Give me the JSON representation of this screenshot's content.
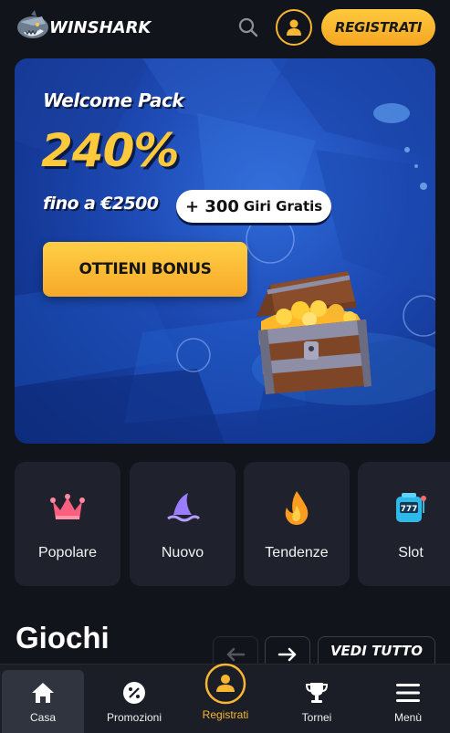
{
  "header": {
    "brand": "WINSHARK",
    "register_label": "REGISTRATI",
    "icons": [
      "shark-logo-icon",
      "search-icon",
      "user-icon"
    ]
  },
  "banner": {
    "title": "Welcome Pack",
    "percent": "240%",
    "upto": "fino a €2500",
    "spins_plus": "+ 300",
    "spins_text": "Giri Gratis",
    "cta": "OTTIENI BONUS"
  },
  "categories": [
    {
      "label": "Popolare",
      "icon": "crown-icon"
    },
    {
      "label": "Nuovo",
      "icon": "shark-fin-icon"
    },
    {
      "label": "Tendenze",
      "icon": "flame-icon"
    },
    {
      "label": "Slot",
      "icon": "slot-machine-icon"
    }
  ],
  "games": {
    "title": "Giochi",
    "view_all": "VEDI TUTTO"
  },
  "bottom_nav": [
    {
      "label": "Casa",
      "icon": "home-icon"
    },
    {
      "label": "Promozioni",
      "icon": "percent-icon"
    },
    {
      "label": "Registrati",
      "icon": "user-icon"
    },
    {
      "label": "Tornei",
      "icon": "trophy-icon"
    },
    {
      "label": "Menù",
      "icon": "hamburger-menu-icon"
    }
  ],
  "colors": {
    "accent": "#f7b731",
    "background": "#12141c",
    "card": "#1f222c"
  }
}
